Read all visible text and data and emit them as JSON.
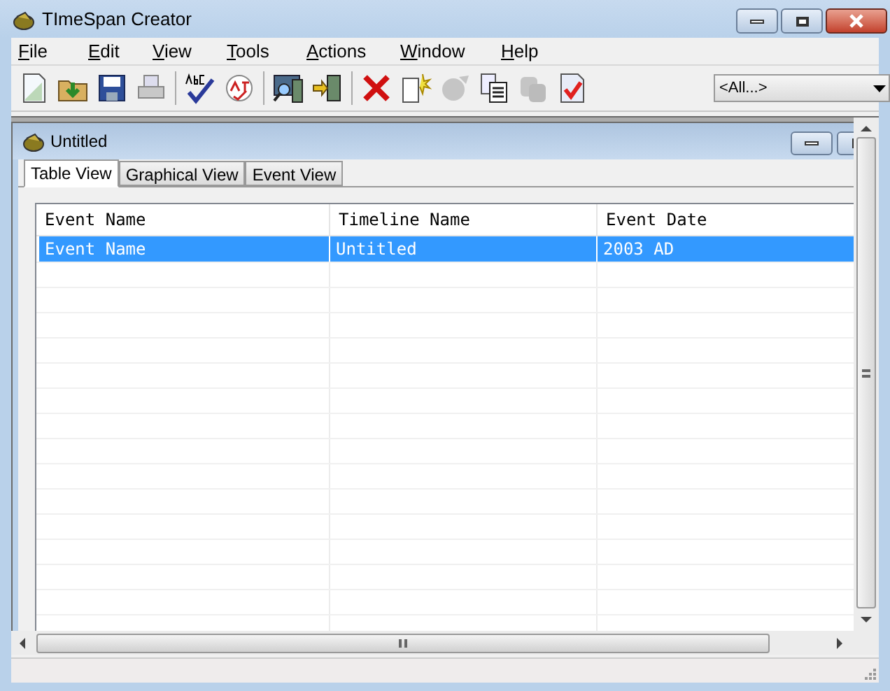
{
  "window": {
    "title": "TImeSpan Creator"
  },
  "menu": [
    "File",
    "Edit",
    "View",
    "Tools",
    "Actions",
    "Window",
    "Help"
  ],
  "toolbar": [
    {
      "disabled": false
    },
    {
      "disabled": false
    },
    {
      "disabled": false
    },
    {
      "disabled": false
    },
    {
      "disabled": false
    },
    {
      "disabled": false
    },
    {
      "disabled": false
    },
    {
      "disabled": false
    },
    {
      "disabled": false
    },
    {
      "disabled": false
    },
    {
      "disabled": true
    },
    {
      "disabled": false
    },
    {
      "disabled": true
    },
    {
      "disabled": false
    }
  ],
  "filter": {
    "value": "<All...>"
  },
  "document": {
    "title": "Untitled",
    "tabs": [
      {
        "label": "Table View",
        "selected": true
      },
      {
        "label": "Graphical View",
        "selected": false
      },
      {
        "label": "Event View",
        "selected": false
      }
    ],
    "table": {
      "columns": [
        "Event Name",
        "Timeline Name",
        "Event Date"
      ],
      "rows": [
        {
          "cells": [
            "Event Name",
            "Untitled",
            "2003 AD"
          ],
          "selected": true
        }
      ]
    }
  }
}
